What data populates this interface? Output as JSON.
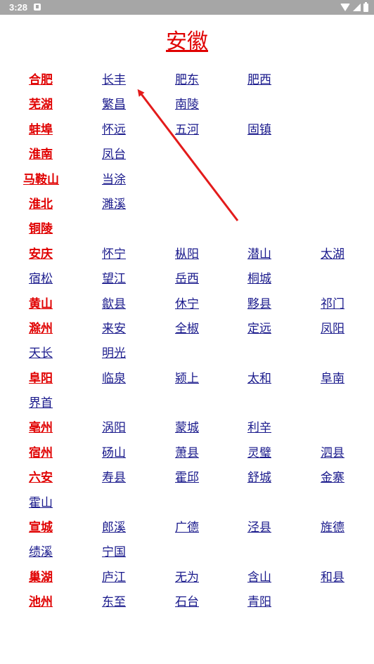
{
  "status_bar": {
    "time": "3:28"
  },
  "page_title": "安徽",
  "rows": [
    [
      "合肥",
      "长丰",
      "肥东",
      "肥西"
    ],
    [
      "芜湖",
      "繁昌",
      "南陵"
    ],
    [
      "蚌埠",
      "怀远",
      "五河",
      "固镇"
    ],
    [
      "淮南",
      "凤台"
    ],
    [
      "马鞍山",
      "当涂"
    ],
    [
      "淮北",
      "濉溪"
    ],
    [
      "铜陵"
    ],
    [
      "安庆",
      "怀宁",
      "枞阳",
      "潜山",
      "太湖"
    ],
    [
      "宿松",
      "望江",
      "岳西",
      "桐城"
    ],
    [
      "黄山",
      "歙县",
      "休宁",
      "黟县",
      "祁门"
    ],
    [
      "滁州",
      "来安",
      "全椒",
      "定远",
      "凤阳"
    ],
    [
      "天长",
      "明光"
    ],
    [
      "阜阳",
      "临泉",
      "颍上",
      "太和",
      "阜南"
    ],
    [
      "界首"
    ],
    [
      "亳州",
      "涡阳",
      "蒙城",
      "利辛"
    ],
    [
      "宿州",
      "砀山",
      "萧县",
      "灵璧",
      "泗县"
    ],
    [
      "六安",
      "寿县",
      "霍邱",
      "舒城",
      "金寨"
    ],
    [
      "霍山"
    ],
    [
      "宣城",
      "郎溪",
      "广德",
      "泾县",
      "旌德"
    ],
    [
      "绩溪",
      "宁国"
    ],
    [
      "巢湖",
      "庐江",
      "无为",
      "含山",
      "和县"
    ],
    [
      "池州",
      "东至",
      "石台",
      "青阳"
    ]
  ],
  "city_rows": [
    0,
    1,
    2,
    3,
    4,
    5,
    6,
    7,
    9,
    10,
    12,
    14,
    15,
    16,
    18,
    20,
    21
  ],
  "colors": {
    "city": "#e00000",
    "county": "#1a1a8c",
    "arrow": "#e31b1b",
    "status_bar": "#a6a6a6"
  }
}
